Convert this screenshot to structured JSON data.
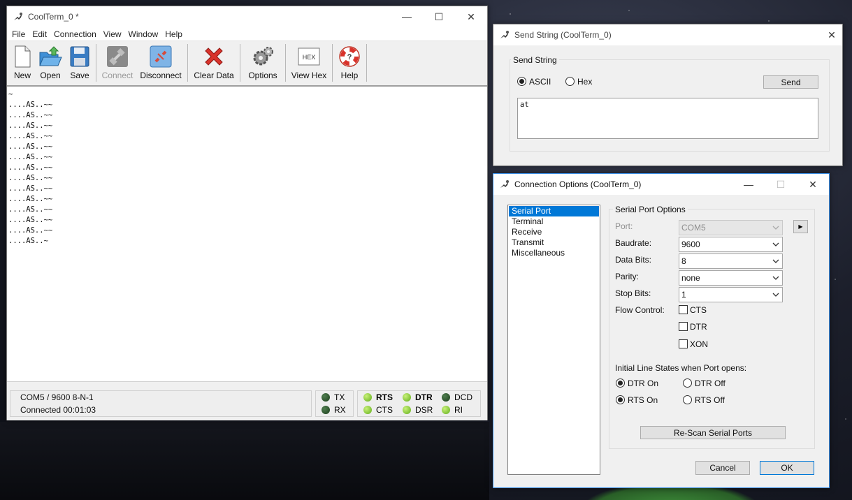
{
  "main_window": {
    "title": "CoolTerm_0 *",
    "menu": [
      "File",
      "Edit",
      "Connection",
      "View",
      "Window",
      "Help"
    ],
    "toolbar": {
      "new": "New",
      "open": "Open",
      "save": "Save",
      "connect": "Connect",
      "disconnect": "Disconnect",
      "clear_data": "Clear Data",
      "options": "Options",
      "view_hex": "View Hex",
      "help": "Help",
      "hex_icon_text": "HEX"
    },
    "terminal_lines": [
      "~",
      "....AS..~~",
      "....AS..~~",
      "....AS..~~",
      "....AS..~~",
      "....AS..~~",
      "....AS..~~",
      "....AS..~~",
      "....AS..~~",
      "....AS..~~",
      "....AS..~~",
      "....AS..~~",
      "....AS..~~",
      "....AS..~~",
      "....AS..~"
    ],
    "status": {
      "port_line": "COM5 / 9600 8-N-1",
      "connection_line": "Connected 00:01:03",
      "tx": "TX",
      "rx": "RX",
      "rts": "RTS",
      "cts": "CTS",
      "dtr": "DTR",
      "dsr": "DSR",
      "dcd": "DCD",
      "ri": "RI"
    }
  },
  "send_window": {
    "title": "Send String (CoolTerm_0)",
    "group_title": "Send String",
    "ascii_label": "ASCII",
    "hex_label": "Hex",
    "send_button": "Send",
    "text_value": "at",
    "mode_selected": "ASCII"
  },
  "conn_window": {
    "title": "Connection Options (CoolTerm_0)",
    "categories": [
      "Serial Port",
      "Terminal",
      "Receive",
      "Transmit",
      "Miscellaneous"
    ],
    "selected_category": "Serial Port",
    "group_title": "Serial Port Options",
    "port_label": "Port:",
    "port_value": "COM5",
    "baudrate_label": "Baudrate:",
    "baudrate_value": "9600",
    "databits_label": "Data Bits:",
    "databits_value": "8",
    "parity_label": "Parity:",
    "parity_value": "none",
    "stopbits_label": "Stop Bits:",
    "stopbits_value": "1",
    "flow_label": "Flow Control:",
    "cts_label": "CTS",
    "dtr_label": "DTR",
    "xon_label": "XON",
    "line_states_label": "Initial Line States when Port opens:",
    "dtr_on": "DTR On",
    "dtr_off": "DTR Off",
    "rts_on": "RTS On",
    "rts_off": "RTS Off",
    "rescan_button": "Re-Scan Serial Ports",
    "cancel_button": "Cancel",
    "ok_button": "OK"
  }
}
